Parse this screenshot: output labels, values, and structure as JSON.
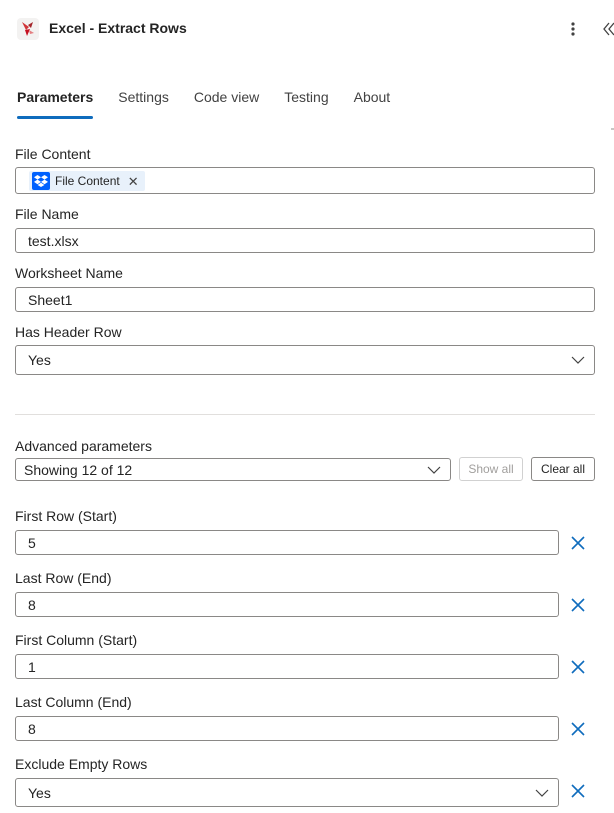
{
  "header": {
    "title": "Excel - Extract Rows",
    "logo_icon": "excel-extract-logo",
    "menu_icon": "more-vertical-icon",
    "collapse_icon": "double-chevron-left-icon"
  },
  "tabs": [
    {
      "label": "Parameters",
      "active": true
    },
    {
      "label": "Settings",
      "active": false
    },
    {
      "label": "Code view",
      "active": false
    },
    {
      "label": "Testing",
      "active": false
    },
    {
      "label": "About",
      "active": false
    }
  ],
  "parameters": {
    "file_content": {
      "label": "File Content",
      "token_label": "File Content",
      "token_icon": "dropbox-icon"
    },
    "file_name": {
      "label": "File Name",
      "value": "test.xlsx"
    },
    "worksheet_name": {
      "label": "Worksheet Name",
      "value": "Sheet1"
    },
    "has_header_row": {
      "label": "Has Header Row",
      "value": "Yes"
    }
  },
  "advanced": {
    "label": "Advanced parameters",
    "selected": "Showing 12 of 12",
    "show_all_label": "Show all",
    "clear_all_label": "Clear all",
    "fields": {
      "first_row": {
        "label": "First Row (Start)",
        "value": "5"
      },
      "last_row": {
        "label": "Last Row (End)",
        "value": "8"
      },
      "first_column": {
        "label": "First Column (Start)",
        "value": "1"
      },
      "last_column": {
        "label": "Last Column (End)",
        "value": "8"
      },
      "exclude_empty_rows": {
        "label": "Exclude Empty Rows",
        "value": "Yes"
      }
    }
  },
  "colors": {
    "accent": "#0f6cbd",
    "remove_x": "#0f6cbd",
    "dropbox": "#0061fe"
  }
}
